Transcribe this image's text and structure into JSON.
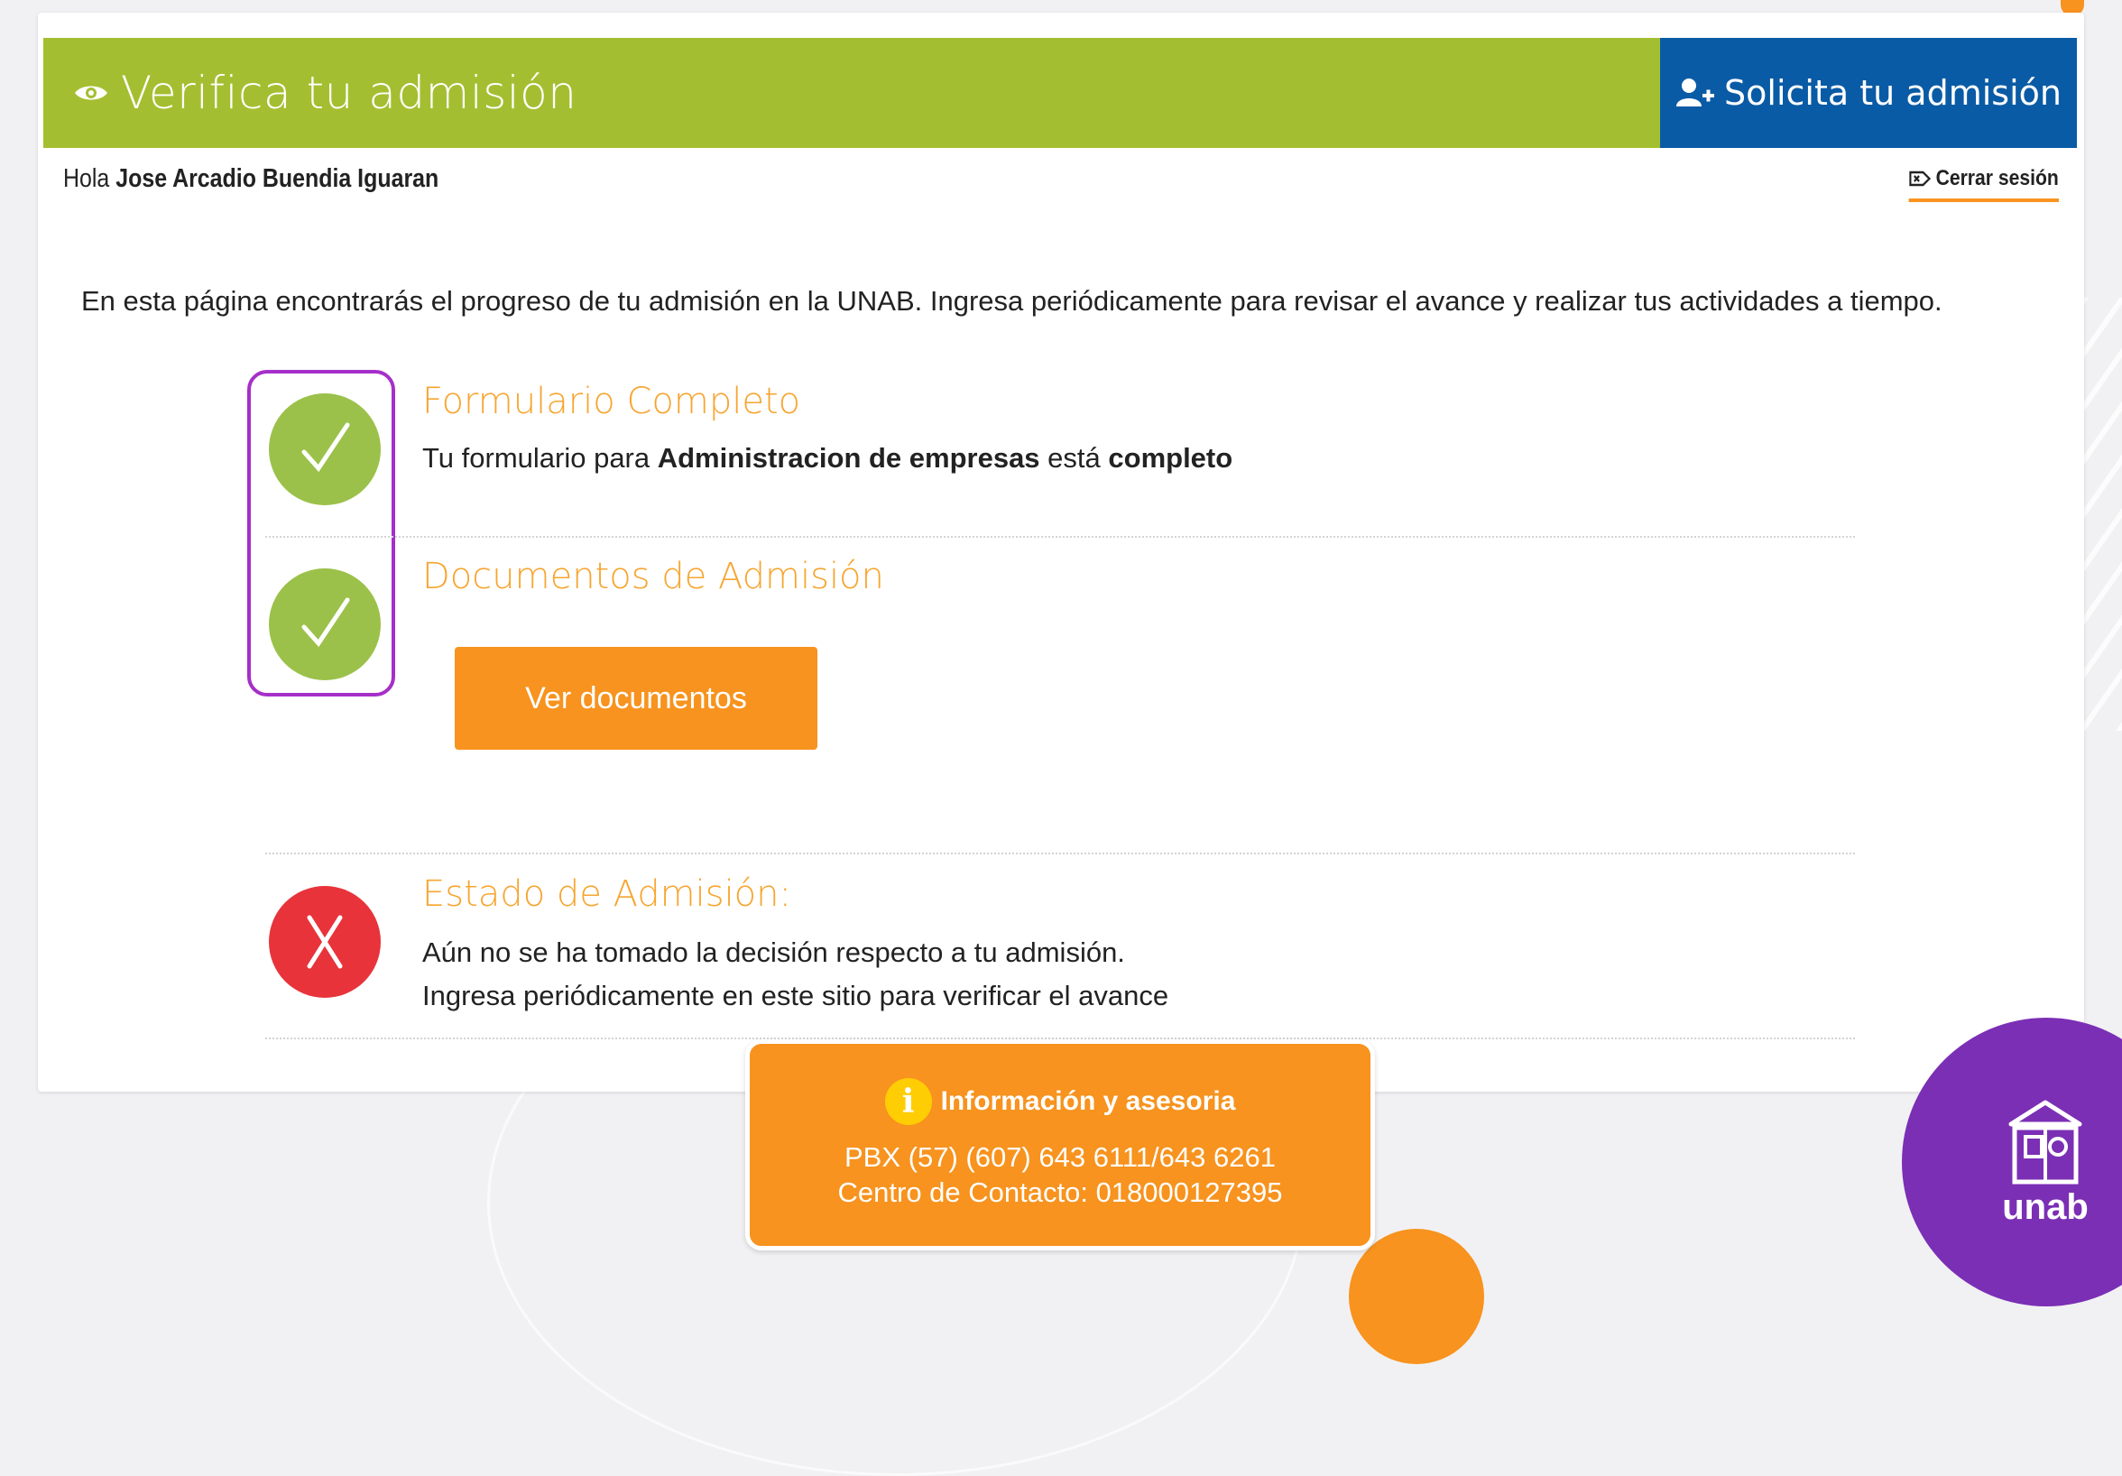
{
  "header": {
    "title": "Verifica tu admisión",
    "apply_button": "Solicita tu admisión"
  },
  "user": {
    "greeting": "Hola",
    "name": "Jose Arcadio Buendia Iguaran",
    "logout_label": "Cerrar sesión"
  },
  "intro_text": "En esta página encontrarás el progreso de tu admisión en la UNAB. Ingresa periódicamente para revisar el avance y realizar tus actividades a tiempo.",
  "steps": {
    "form": {
      "title": "Formulario Completo",
      "text_prefix": "Tu formulario para ",
      "program": "Administracion de empresas",
      "text_middle": " está ",
      "status": "completo",
      "state": "ok"
    },
    "documents": {
      "title": "Documentos de Admisión",
      "button": "Ver documentos",
      "state": "ok"
    },
    "admission": {
      "title": "Estado de Admisión:",
      "line1": "Aún no se ha tomado la decisión respecto a tu admisión.",
      "line2": "Ingresa periódicamente en este sitio para verificar el avance",
      "state": "pending"
    }
  },
  "info": {
    "title": "Información y asesoria",
    "icon_letter": "i",
    "phone": "PBX (57) (607) 643 6111/643 6261",
    "contact_center": "Centro de Contacto: 018000127395"
  },
  "logo": {
    "text": "unab"
  },
  "colors": {
    "header_green": "#a3bf31",
    "apply_blue": "#0a5ba5",
    "accent_orange": "#f7931e",
    "title_orange": "#f7a530",
    "ok_green": "#9bc14a",
    "fail_red": "#e8333b",
    "highlight_purple": "#a62fc9",
    "logo_purple": "#7b2fb5"
  }
}
